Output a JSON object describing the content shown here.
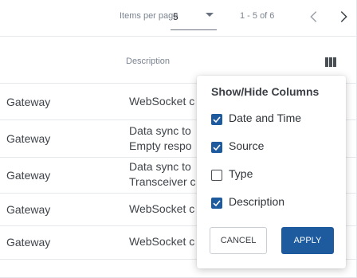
{
  "pagination": {
    "items_per_page_label": "Items per page",
    "items_per_page_value": "5",
    "range_text": "1 - 5 of 6"
  },
  "table": {
    "columns": {
      "description": "Description"
    },
    "rows": [
      {
        "source": "Gateway",
        "description_lines": [
          "WebSocket c"
        ]
      },
      {
        "source": "Gateway",
        "description_lines": [
          "Data sync to",
          "Empty respo"
        ]
      },
      {
        "source": "Gateway",
        "description_lines": [
          "Data sync to",
          "Transceiver c"
        ]
      },
      {
        "source": "Gateway",
        "description_lines": [
          "WebSocket c"
        ]
      },
      {
        "source": "Gateway",
        "description_lines": [
          "WebSocket c"
        ]
      }
    ]
  },
  "column_popup": {
    "title": "Show/Hide Columns",
    "options": [
      {
        "label": "Date and Time",
        "checked": true
      },
      {
        "label": "Source",
        "checked": true
      },
      {
        "label": "Type",
        "checked": false
      },
      {
        "label": "Description",
        "checked": true
      }
    ],
    "cancel_label": "CANCEL",
    "apply_label": "APPLY"
  },
  "colors": {
    "accent": "#1d5a9e",
    "text": "#3a3f45",
    "muted": "#7b8491",
    "border": "#e6e9ec"
  },
  "icons": {
    "prev": "chevron-left-icon",
    "next": "chevron-right-icon",
    "columns": "columns-icon",
    "dropdown": "caret-down-icon",
    "check": "checkmark-icon"
  }
}
